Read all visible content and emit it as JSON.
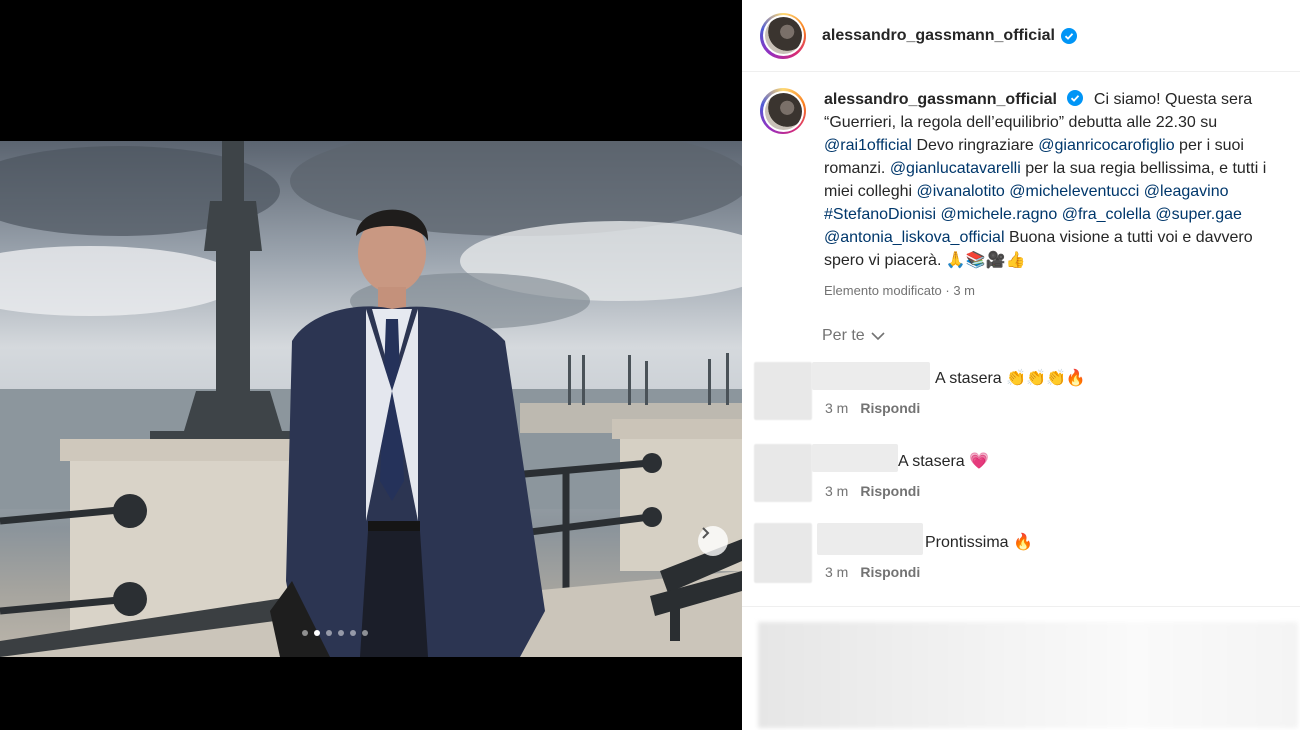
{
  "post": {
    "username": "alessandro_gassmann_official",
    "caption_intro": "Ci siamo! Questa sera “Guerrieri, la regola dell’equilibrio” debutta alle 22.30 su",
    "mention_rai": "@rai1official",
    "text_2": "Devo ringraziare",
    "mention_carofiglio": "@gianricocarofiglio",
    "text_3": "per i suoi romanzi.",
    "mention_tavarelli": "@gianlucatavarelli",
    "text_4": "per la sua regia bellissima, e tutti i miei colleghi",
    "mention_lotito": "@ivanalotito",
    "mention_venitucci": "@micheleventucci",
    "mention_gavino": "@leagavino",
    "hashtag_dionisi": "#StefanoDionisi",
    "mention_ragno": "@michele.ragno",
    "mention_colella": "@fra_colella",
    "mention_gae": "@super.gae",
    "mention_liskova": "@antonia_liskova_official",
    "text_5": "Buona visione a tutti voi e davvero spero vi piacerà.",
    "emoji": "🙏📚🎥👍",
    "meta": "Elemento modificato · 3 m"
  },
  "sort": {
    "label": "Per te"
  },
  "comments": [
    {
      "text": "A stasera 👏👏👏🔥",
      "time": "3 m",
      "reply": "Rispondi"
    },
    {
      "text": "A stasera 💗",
      "time": "3 m",
      "reply": "Rispondi"
    },
    {
      "text": "Prontissima 🔥",
      "time": "3 m",
      "reply": "Rispondi"
    }
  ],
  "carousel": {
    "slides": 6,
    "active_index": 1
  },
  "colors": {
    "link": "#00376b",
    "verified": "#0095f6",
    "muted": "#737373"
  },
  "icons": {
    "verified": "verified-badge-icon",
    "next": "chevron-right-icon",
    "dropdown": "chevron-down-icon"
  }
}
